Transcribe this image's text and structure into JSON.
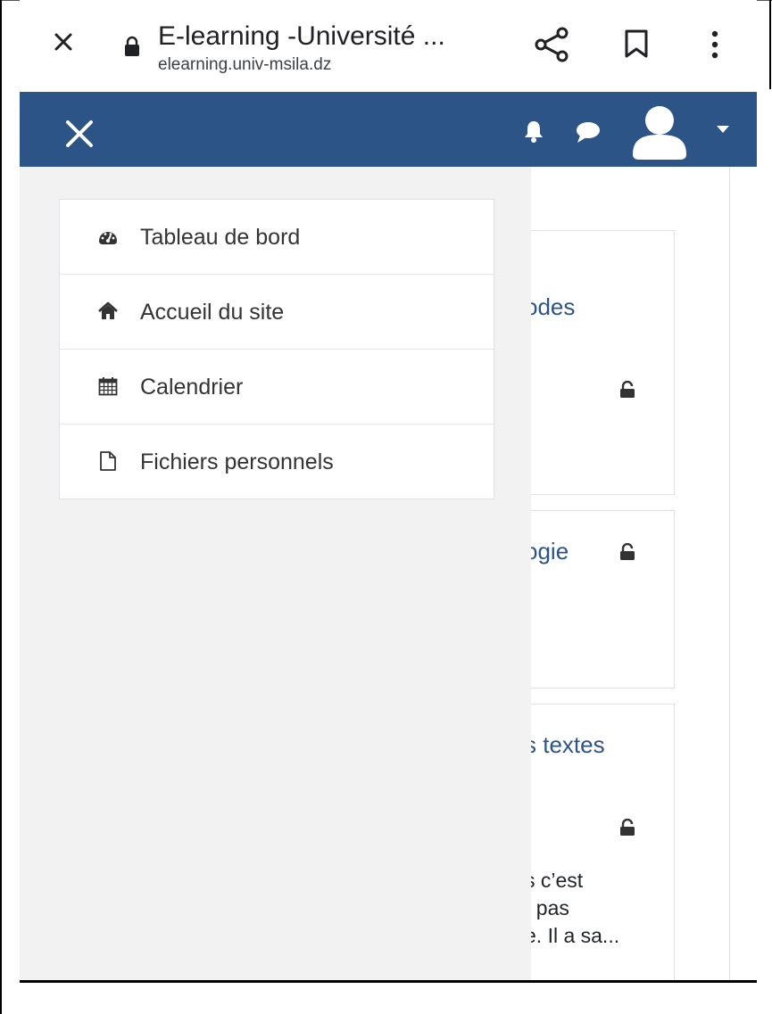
{
  "browser": {
    "title": "E-learning -Université ...",
    "url": "elearning.univ-msila.dz"
  },
  "drawer": {
    "items": [
      {
        "label": "Tableau de bord",
        "icon": "dashboard-icon"
      },
      {
        "label": "Accueil du site",
        "icon": "home-icon"
      },
      {
        "label": "Calendrier",
        "icon": "calendar-icon"
      },
      {
        "label": "Fichiers personnels",
        "icon": "file-icon"
      }
    ]
  },
  "background": {
    "card1_title": "odes",
    "card2_title": "ogie",
    "card3_title": "s textes",
    "card3_line1": "s c’est",
    "card3_line2": "t pas",
    "card3_line3": "e. Il a sa..."
  },
  "colors": {
    "navbar": "#2d5487",
    "drawer_bg": "#f2f2f2",
    "link": "#2d5487"
  }
}
